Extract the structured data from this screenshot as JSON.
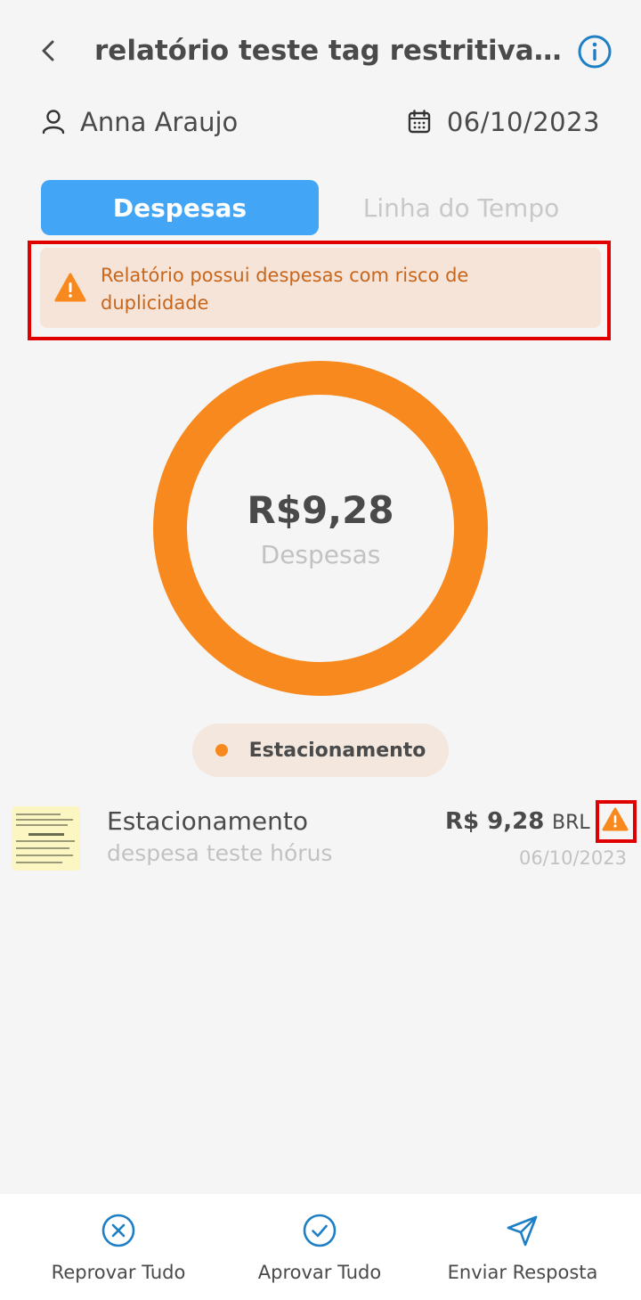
{
  "header": {
    "title": "relatório teste tag restritiva hórus",
    "back_icon": "chevron-left-icon",
    "info_icon": "info-circle-icon"
  },
  "meta": {
    "user_name": "Anna Araujo",
    "user_icon": "user-icon",
    "date": "06/10/2023",
    "date_icon": "calendar-icon"
  },
  "tabs": [
    {
      "label": "Despesas",
      "active": true
    },
    {
      "label": "Linha do Tempo",
      "active": false
    }
  ],
  "alert": {
    "message": "Relatório possui despesas com risco de duplicidade",
    "icon": "warning-icon"
  },
  "summary": {
    "total": "R$9,28",
    "label": "Despesas"
  },
  "chart_data": {
    "type": "pie",
    "categories": [
      "Estacionamento"
    ],
    "values": [
      9.28
    ],
    "colors": [
      "#f7891f"
    ],
    "donut": true
  },
  "legend": [
    {
      "label": "Estacionamento",
      "color": "#f7891f"
    }
  ],
  "expenses": [
    {
      "name": "Estacionamento",
      "description": "despesa teste hórus",
      "amount": "R$ 9,28",
      "currency": "BRL",
      "date": "06/10/2023",
      "warning_icon": "warning-icon"
    }
  ],
  "actions": [
    {
      "label": "Reprovar Tudo",
      "icon": "x-circle-icon"
    },
    {
      "label": "Aprovar Tudo",
      "icon": "check-circle-icon"
    },
    {
      "label": "Enviar Resposta",
      "icon": "send-icon"
    }
  ],
  "colors": {
    "accent": "#42a5f5",
    "warning": "#f7891f",
    "alert_text": "#c8661c",
    "alert_bg": "#f6e4d8",
    "icon_blue": "#1e7fc4"
  }
}
